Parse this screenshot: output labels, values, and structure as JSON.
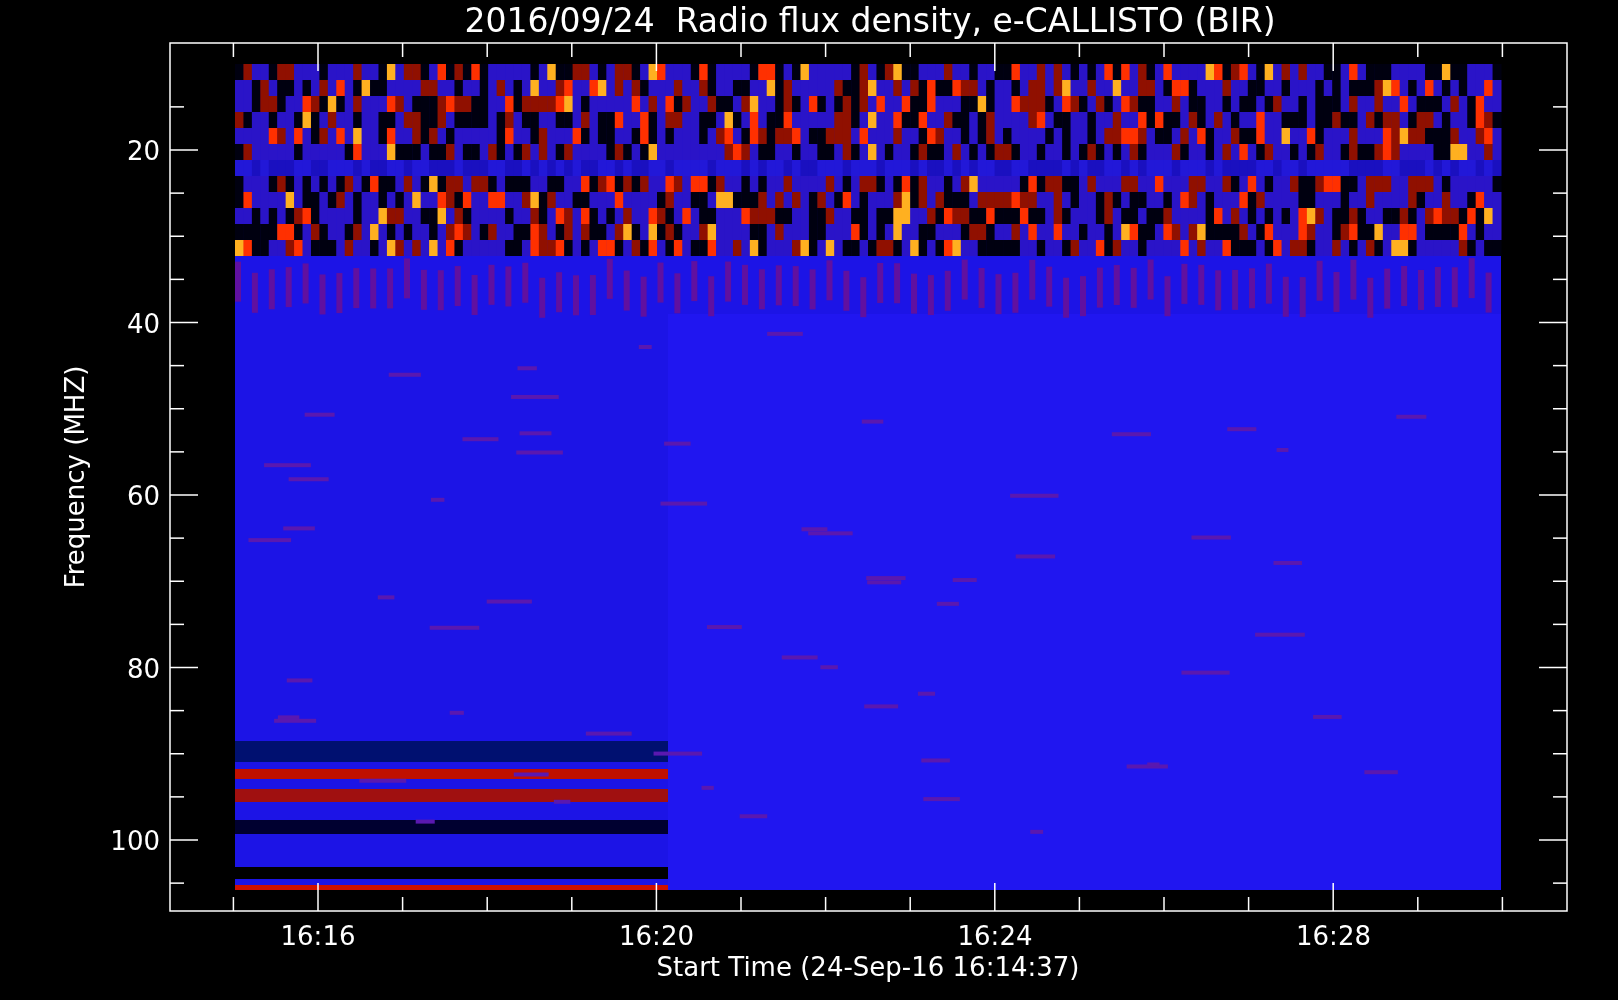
{
  "title": "2016/09/24  Radio flux density, e-CALLISTO (BIR)",
  "y_axis": {
    "label": "Frequency (MHZ)",
    "ticks": [
      "20",
      "40",
      "60",
      "80",
      "100"
    ]
  },
  "x_axis": {
    "label": "Start Time (24-Sep-16 16:14:37)",
    "ticks": [
      "16:16",
      "16:20",
      "16:24",
      "16:28"
    ]
  }
}
